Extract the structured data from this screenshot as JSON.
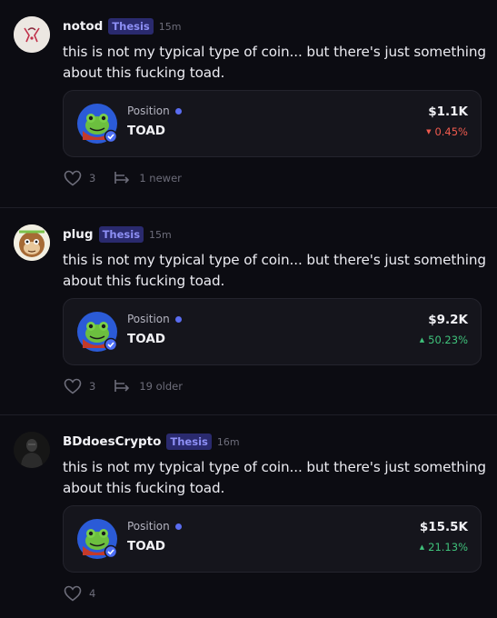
{
  "posts": [
    {
      "username": "notod",
      "badge": "Thesis",
      "time": "15m",
      "text": "this is not my typical type of coin... but there's just something about this fucking toad.",
      "card": {
        "label": "Position",
        "ticker": "TOAD",
        "value": "$1.1K",
        "change": "0.45%",
        "direction": "down"
      },
      "likes": "3",
      "thread": "1 newer"
    },
    {
      "username": "plug",
      "badge": "Thesis",
      "time": "15m",
      "text": "this is not my typical type of coin... but there's just something about this fucking toad.",
      "card": {
        "label": "Position",
        "ticker": "TOAD",
        "value": "$9.2K",
        "change": "50.23%",
        "direction": "up"
      },
      "likes": "3",
      "thread": "19 older"
    },
    {
      "username": "BDdoesCrypto",
      "badge": "Thesis",
      "time": "16m",
      "text": "this is not my typical type of coin... but there's just something about this fucking toad.",
      "card": {
        "label": "Position",
        "ticker": "TOAD",
        "value": "$15.5K",
        "change": "21.13%",
        "direction": "up"
      },
      "likes": "4"
    }
  ],
  "colors": {
    "accent": "#5a6cf0",
    "badge_bg": "#2a2a6e",
    "badge_text": "#8d8ff5",
    "up": "#3fc27b",
    "down": "#ef5a4e"
  }
}
